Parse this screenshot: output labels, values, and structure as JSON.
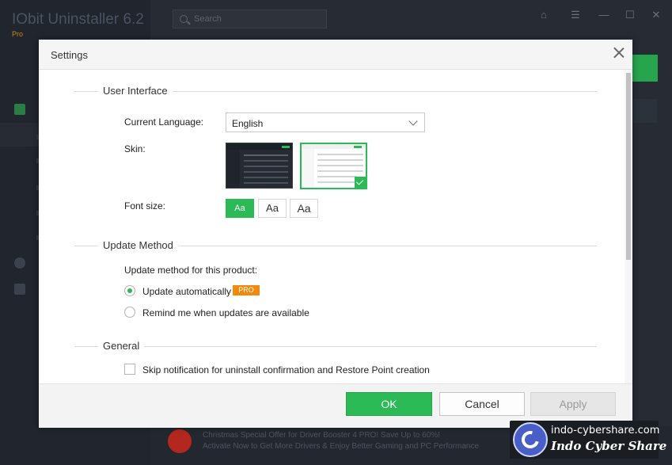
{
  "app": {
    "title": "IObit Uninstaller 6.2",
    "edition": "Pro",
    "search_placeholder": "Search",
    "promo_line1": "Christmas Special Offer for Driver Booster 4 PRO! Save Up to 60%!",
    "promo_line2": "Activate Now to Get More Drivers & Enjoy Better Gaming and PC Performance"
  },
  "watermark": {
    "url": "indo-cybershare.com",
    "name": "Indo Cyber Share"
  },
  "dialog": {
    "title": "Settings",
    "sections": {
      "user_interface": "User Interface",
      "update_method": "Update Method",
      "general": "General"
    },
    "language": {
      "label": "Current Language:",
      "value": "English"
    },
    "skin": {
      "label": "Skin:",
      "options": [
        "dark",
        "light"
      ],
      "selected": "light"
    },
    "font_size": {
      "label": "Font size:",
      "options": [
        "Aa",
        "Aa",
        "Aa"
      ],
      "selected_index": 0
    },
    "update": {
      "prompt": "Update method for this product:",
      "auto_label": "Update automatically",
      "pro_badge": "PRO",
      "remind_label": "Remind me when updates are available",
      "selected": "auto"
    },
    "general": {
      "skip_label": "Skip notification for uninstall confirmation and Restore Point creation",
      "skip_checked": false
    },
    "buttons": {
      "ok": "OK",
      "cancel": "Cancel",
      "apply": "Apply"
    }
  },
  "colors": {
    "accent": "#2bba55",
    "pro_badge": "#f08a0f",
    "app_background": "#1e222b"
  }
}
